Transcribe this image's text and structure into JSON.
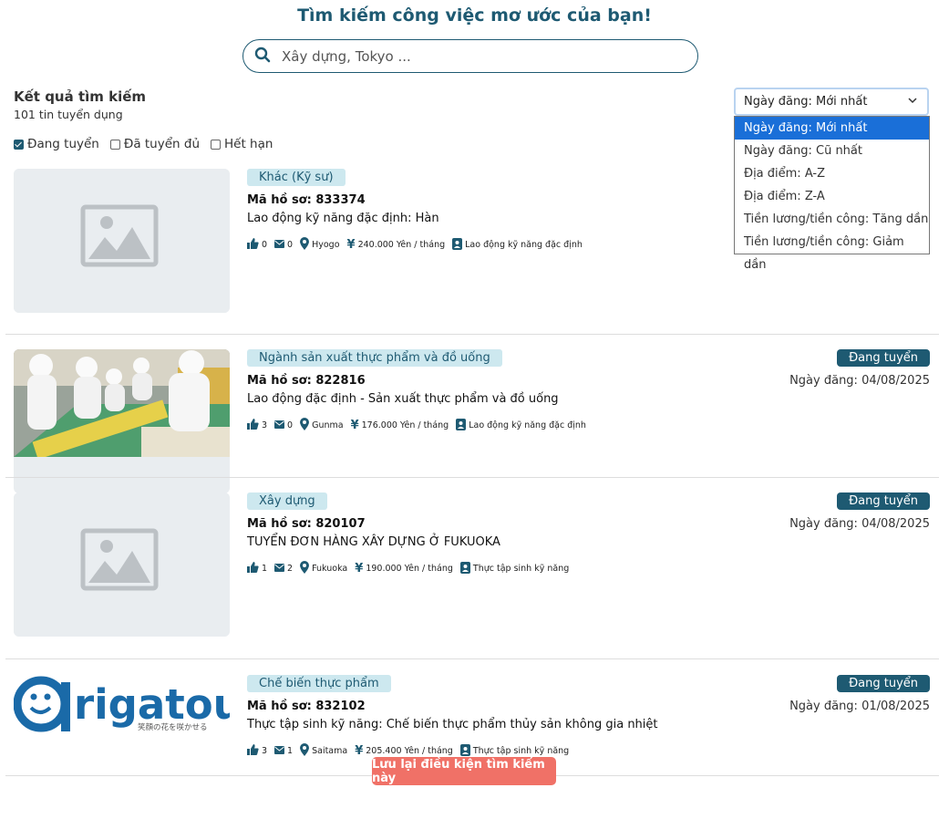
{
  "header": {
    "title": "Tìm kiếm công việc mơ ước của bạn!"
  },
  "search": {
    "placeholder": "Xây dựng, Tokyo ...",
    "value": ""
  },
  "results": {
    "title": "Kết quả tìm kiếm",
    "count": "101 tin tuyển dụng"
  },
  "filters": [
    {
      "label": "Đang tuyển",
      "checked": true
    },
    {
      "label": "Đã tuyển đủ",
      "checked": false
    },
    {
      "label": "Hết hạn",
      "checked": false
    }
  ],
  "sort": {
    "selected": "Ngày đăng: Mới nhất",
    "options": [
      "Ngày đăng: Mới nhất",
      "Ngày đăng: Cũ nhất",
      "Địa điểm: A-Z",
      "Địa điểm: Z-A",
      "Tiền lương/tiền công: Tăng dần",
      "Tiền lương/tiền công: Giảm dần"
    ]
  },
  "jobs": [
    {
      "category": "Khác (Kỹ sư)",
      "code": "Mã hồ sơ: 833374",
      "title": "Lao động kỹ năng đặc định: Hàn",
      "likes": "0",
      "messages": "0",
      "location": "Hyogo",
      "salary": "240.000 Yên / tháng",
      "visa": "Lao động kỹ năng đặc định",
      "status": "",
      "date": "",
      "image": "placeholder"
    },
    {
      "category": "Ngành sản xuất thực phẩm và đồ uống",
      "code": "Mã hồ sơ: 822816",
      "title": "Lao động đặc định - Sản xuất thực phẩm và đồ uống",
      "likes": "3",
      "messages": "0",
      "location": "Gunma",
      "salary": "176.000 Yên / tháng",
      "visa": "Lao động kỹ năng đặc định",
      "status": "Đang tuyển",
      "date": "Ngày đăng: 04/08/2025",
      "image": "factory-photo"
    },
    {
      "category": "Xây dựng",
      "code": "Mã hồ sơ: 820107",
      "title": "TUYỂN ĐƠN HÀNG XÂY DỰNG Ở FUKUOKA",
      "likes": "1",
      "messages": "2",
      "location": "Fukuoka",
      "salary": "190.000 Yên / tháng",
      "visa": "Thực tập sinh kỹ năng",
      "status": "Đang tuyển",
      "date": "Ngày đăng: 04/08/2025",
      "image": "placeholder"
    },
    {
      "category": "Chế biến thực phẩm",
      "code": "Mã hồ sơ: 832102",
      "title": "Thực tập sinh kỹ năng: Chế biến thực phẩm thủy sản không gia nhiệt",
      "likes": "3",
      "messages": "1",
      "location": "Saitama",
      "salary": "205.400 Yên / tháng",
      "visa": "Thực tập sinh kỹ năng",
      "status": "Đang tuyển",
      "date": "Ngày đăng: 01/08/2025",
      "image": "company-logo"
    }
  ],
  "logo": {
    "text": "rigatou",
    "tagline": "笑顔の花を咲かせる"
  },
  "save_button": "Lưu lại điều kiện tìm kiếm này",
  "colors": {
    "primary": "#1e5a72",
    "tag_bg": "#cde8ef",
    "save": "#f07167",
    "dropdown_active": "#1a6fd8"
  }
}
